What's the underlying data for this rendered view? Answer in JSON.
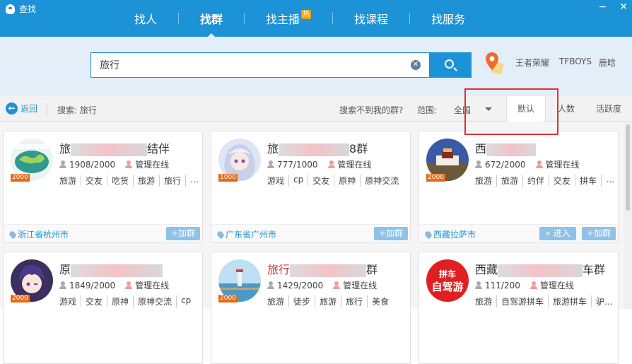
{
  "window": {
    "title": "查找",
    "controls": [
      "−",
      "✕"
    ]
  },
  "nav": {
    "tabs": [
      {
        "label": "找人"
      },
      {
        "label": "找群"
      },
      {
        "label": "找主播",
        "badge": "热"
      },
      {
        "label": "找课程"
      },
      {
        "label": "找服务"
      }
    ]
  },
  "search": {
    "value": "旅行",
    "clear_icon": "✕",
    "hot_words": [
      "王者荣耀",
      "TFBOYS",
      "鹿晗"
    ]
  },
  "filter": {
    "back_label": "返回",
    "keyword_text": "搜索: 旅行",
    "not_found_link": "搜索不到我的群?",
    "range_label": "范围:",
    "range_value": "全国",
    "sort_tabs": [
      "默认",
      "人数",
      "活跃度"
    ]
  },
  "groups": [
    {
      "name_prefix": "旅",
      "name_suffix": "结伴",
      "members": "1908/2000",
      "admin": "管理在线",
      "tags": [
        "旅游",
        "交友",
        "吃货",
        "旅游",
        "旅行",
        "…"
      ],
      "location": "浙江省杭州市",
      "cap": "2000",
      "actions": [
        "+加群"
      ]
    },
    {
      "name_prefix": "旅",
      "name_suffix": "8群",
      "members": "777/1000",
      "admin": "管理在线",
      "tags": [
        "游戏",
        "cp",
        "交友",
        "原神",
        "原神交流"
      ],
      "location": "广东省广州市",
      "cap": "1000",
      "actions": [
        "+加群"
      ]
    },
    {
      "name_prefix": "西",
      "name_suffix": "",
      "members": "672/2000",
      "admin": "管理在线",
      "tags": [
        "旅游",
        "旅游",
        "约伴",
        "交友",
        "拼车",
        "…"
      ],
      "location": "西藏拉萨市",
      "cap": "2000",
      "actions": [
        "» 进入",
        "+加群"
      ]
    },
    {
      "name_prefix": "原",
      "name_suffix": "",
      "members": "1849/2000",
      "admin": "管理在线",
      "tags": [
        "游戏",
        "交友",
        "原神",
        "原神交流",
        "cp"
      ],
      "location": "",
      "cap": "2000",
      "actions": []
    },
    {
      "name_prefix": "旅行",
      "name_suffix": "群",
      "members": "1429/2000",
      "admin": "管理在线",
      "tags": [
        "旅游",
        "徒步",
        "旅游",
        "旅行",
        "美食"
      ],
      "location": "",
      "cap": "2000",
      "actions": []
    },
    {
      "name_prefix": "西藏",
      "name_suffix": "车群",
      "members": "111/200",
      "admin": "管理在线",
      "tags": [
        "旅游",
        "自驾游拼车",
        "旅游拼车",
        "驴…"
      ],
      "location": "",
      "cap": "",
      "avatar_text": [
        "拼车",
        "自驾游"
      ],
      "actions": []
    }
  ],
  "colors": {
    "brand": "#1b93d6",
    "highlight_box": "#e03030",
    "cap_badge": "#e56b1a",
    "join_button": "#8ec2e8"
  }
}
